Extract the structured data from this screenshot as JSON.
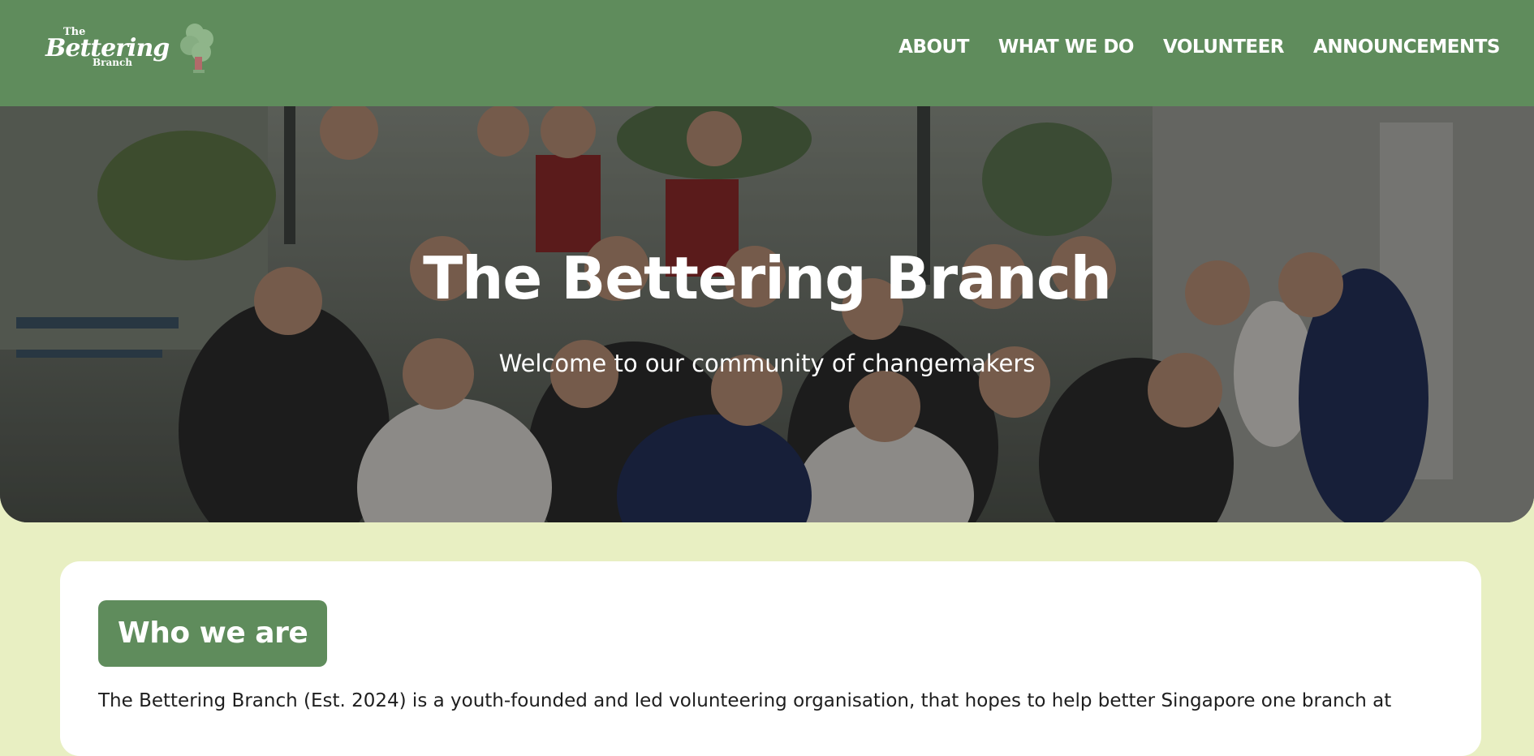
{
  "header": {
    "logo": {
      "the": "The",
      "name": "Bettering",
      "branch": "Branch"
    },
    "nav": [
      {
        "label": "ABOUT"
      },
      {
        "label": "WHAT WE DO"
      },
      {
        "label": "VOLUNTEER"
      },
      {
        "label": "ANNOUNCEMENTS"
      }
    ]
  },
  "hero": {
    "title": "The Bettering Branch",
    "subtitle": "Welcome to our community of changemakers"
  },
  "about": {
    "heading": "Who we are",
    "body": "The Bettering Branch (Est. 2024) is a youth-founded and led volunteering organisation, that hopes to help better Singapore one branch at"
  },
  "colors": {
    "brand_green": "#5f8c5c",
    "page_background": "#e8efc2",
    "card_background": "#ffffff"
  }
}
